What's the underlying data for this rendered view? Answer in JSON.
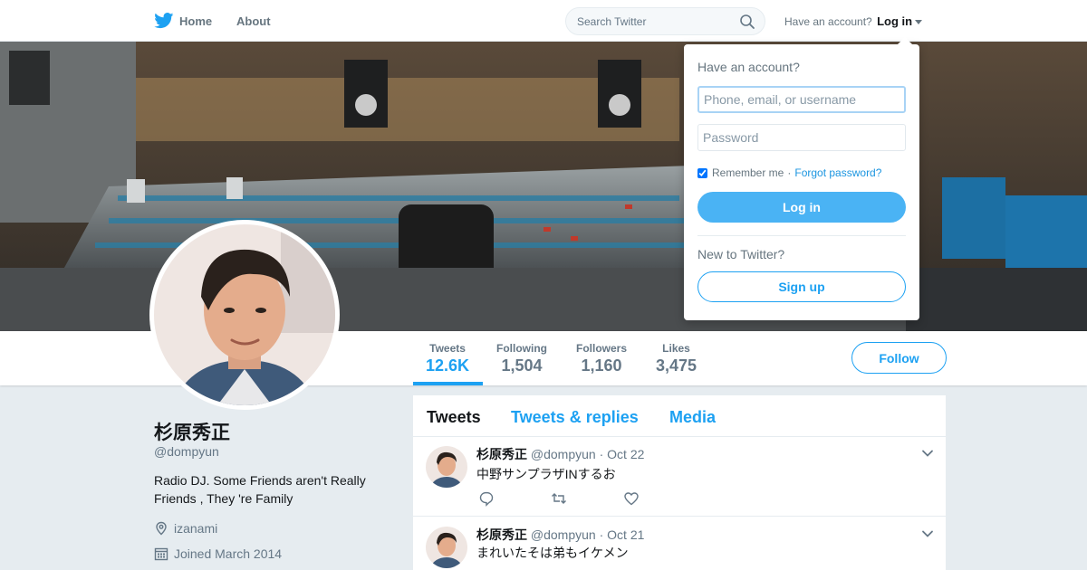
{
  "nav": {
    "home_label": "Home",
    "about_label": "About",
    "search_placeholder": "Search Twitter",
    "have_account_text": "Have an account?",
    "login_label": "Log in"
  },
  "colors": {
    "brand_blue": "#1da1f2",
    "login_button": "#4ab3f4",
    "muted_text": "#657786"
  },
  "stats": [
    {
      "label": "Tweets",
      "value": "12.6K"
    },
    {
      "label": "Following",
      "value": "1,504"
    },
    {
      "label": "Followers",
      "value": "1,160"
    },
    {
      "label": "Likes",
      "value": "3,475"
    }
  ],
  "follow_label": "Follow",
  "profile": {
    "name": "杉原秀正",
    "handle": "@dompyun",
    "bio": "Radio DJ. Some Friends aren't Really Friends , They 're Family",
    "location": "izanami",
    "joined": "Joined March 2014",
    "location_icon": "location-pin-icon",
    "joined_icon": "calendar-icon"
  },
  "timeline": {
    "tabs": [
      "Tweets",
      "Tweets & replies",
      "Media"
    ],
    "tweets": [
      {
        "name": "杉原秀正",
        "handle": "@dompyun",
        "date": "· Oct 22",
        "text": "中野サンプラザINするお"
      },
      {
        "name": "杉原秀正",
        "handle": "@dompyun",
        "date": "· Oct 21",
        "text": "まれいたそは弟もイケメン"
      }
    ]
  },
  "login_dropdown": {
    "title": "Have an account?",
    "username_placeholder": "Phone, email, or username",
    "password_placeholder": "Password",
    "remember_label": "Remember me",
    "separator": "·",
    "forgot_label": "Forgot password?",
    "login_button": "Log in",
    "new_text": "New to Twitter?",
    "signup_button": "Sign up"
  }
}
